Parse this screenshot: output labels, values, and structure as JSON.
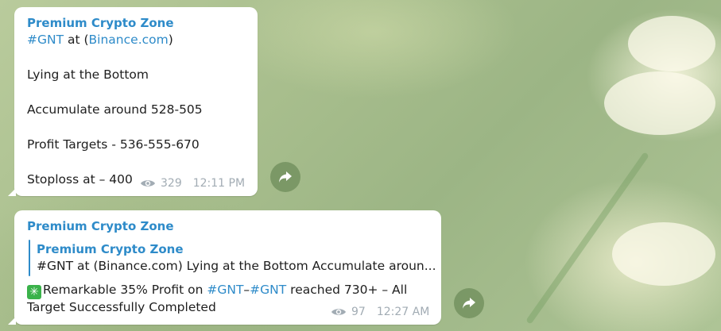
{
  "messages": [
    {
      "author": "Premium Crypto Zone",
      "line1": {
        "tag": "#GNT",
        "middle": " at (",
        "link": "Binance.com",
        "end": ")"
      },
      "line2": "Lying at the Bottom",
      "line3": "Accumulate around 528-505",
      "line4": "Profit Targets - 536-555-670",
      "line5": "Stoploss at – 400",
      "views": "329",
      "time": "12:11 PM"
    },
    {
      "author": "Premium Crypto Zone",
      "forwarded": {
        "author": "Premium Crypto Zone",
        "text": "#GNT at (Binance.com)  Lying at the Bottom  Accumulate aroun..."
      },
      "body": {
        "emoji": "✳",
        "part1": "Remarkable 35% Profit on ",
        "tag1": "#GNT",
        "dash": "–",
        "tag2": "#GNT",
        "part2": " reached 730+ – All",
        "line2": "Target Successfully Completed"
      },
      "views": "97",
      "time": "12:27 AM"
    }
  ],
  "icons": {
    "views": "eye-icon",
    "share": "share-arrow-icon",
    "emoji": "sparkle-check-emoji"
  },
  "colors": {
    "link": "#2e8bc9",
    "meta": "#a2acb4",
    "bubble": "#ffffff"
  }
}
